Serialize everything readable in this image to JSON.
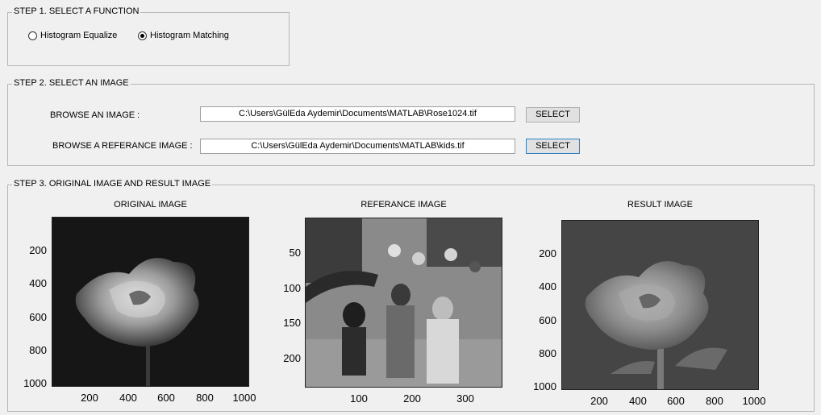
{
  "step1": {
    "title": "STEP 1. SELECT A FUNCTION",
    "options": [
      {
        "label": "Histogram Equalize",
        "checked": false
      },
      {
        "label": "Histogram Matching",
        "checked": true
      }
    ]
  },
  "step2": {
    "title": "STEP 2. SELECT AN IMAGE",
    "browse_image_label": "BROWSE AN IMAGE :",
    "browse_image_path": "C:\\Users\\GülEda Aydemir\\Documents\\MATLAB\\Rose1024.tif",
    "browse_ref_label": "BROWSE A REFERANCE IMAGE :",
    "browse_ref_path": "C:\\Users\\GülEda Aydemir\\Documents\\MATLAB\\kids.tif",
    "select_label": "SELECT"
  },
  "step3": {
    "title": "STEP 3. ORIGINAL IMAGE AND RESULT IMAGE",
    "original": {
      "title": "ORIGINAL IMAGE",
      "yticks": [
        "200",
        "400",
        "600",
        "800",
        "1000"
      ],
      "xticks": [
        "200",
        "400",
        "600",
        "800",
        "1000"
      ]
    },
    "reference": {
      "title": "REFERANCE IMAGE",
      "yticks": [
        "50",
        "100",
        "150",
        "200"
      ],
      "xticks": [
        "100",
        "200",
        "300"
      ]
    },
    "result": {
      "title": "RESULT IMAGE",
      "yticks": [
        "200",
        "400",
        "600",
        "800",
        "1000"
      ],
      "xticks": [
        "200",
        "400",
        "600",
        "800",
        "1000"
      ]
    }
  }
}
